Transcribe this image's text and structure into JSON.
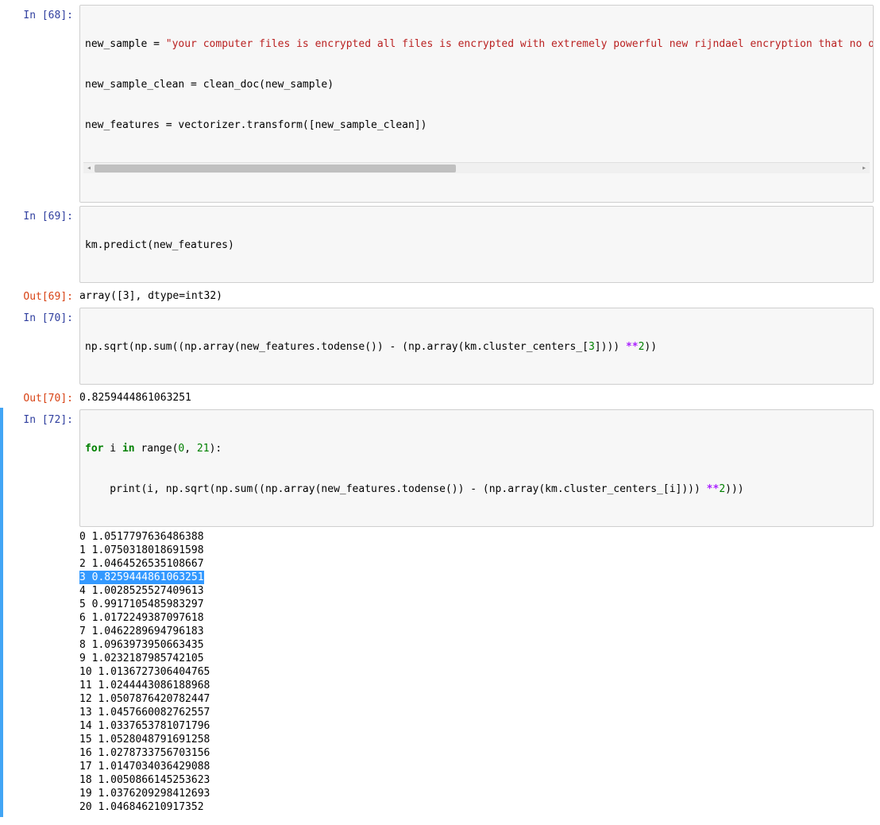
{
  "cells": {
    "c68": {
      "prompt": "In [68]:",
      "line1_pre": "new_sample ",
      "line1_eq": "= ",
      "line1_str": "\"your computer files is encrypted all files is encrypted with extremely powerful new rijndael encryption that no one",
      "line2": "new_sample_clean = clean_doc(new_sample)",
      "line3": "new_features = vectorizer.transform([new_sample_clean])"
    },
    "c69": {
      "prompt": "In [69]:",
      "code": "km.predict(new_features)"
    },
    "c69o": {
      "prompt": "Out[69]:",
      "text": "array([3], dtype=int32)"
    },
    "c70": {
      "prompt": "In [70]:",
      "pre": "np.sqrt(np.sum((np.array(new_features.todense()) - (np.array(km.cluster_centers_[",
      "idx": "3",
      "mid": "]))) ",
      "op": "**",
      "exp": "2",
      "post": "))"
    },
    "c70o": {
      "prompt": "Out[70]:",
      "text": "0.8259444861063251"
    },
    "c72": {
      "prompt": "In [72]:",
      "l1_for": "for",
      "l1_a": " i ",
      "l1_in": "in",
      "l1_b": " range(",
      "l1_n0": "0",
      "l1_c": ", ",
      "l1_n1": "21",
      "l1_d": "):",
      "l2_pre": "    print(i, np.sqrt(np.sum((np.array(new_features.todense()) - (np.array(km.cluster_centers_[i]))) ",
      "l2_op": "**",
      "l2_exp": "2",
      "l2_post": ")))",
      "out": [
        "0 1.0517797636486388",
        "1 1.0750318018691598",
        "2 1.0464526535108667",
        "3 0.8259444861063251",
        "4 1.0028525527409613",
        "5 0.9917105485983297",
        "6 1.0172249387097618",
        "7 1.0462289694796183",
        "8 1.0963973950663435",
        "9 1.0232187985742105",
        "10 1.0136727306404765",
        "11 1.0244443086188968",
        "12 1.0507876420782447",
        "13 1.0457660082762557",
        "14 1.0337653781071796",
        "15 1.0528048791691258",
        "16 1.0278733756703156",
        "17 1.0147034036429088",
        "18 1.0050866145253623",
        "19 1.0376209298412693",
        "20 1.046846210917352"
      ],
      "highlight_index": 3
    }
  }
}
